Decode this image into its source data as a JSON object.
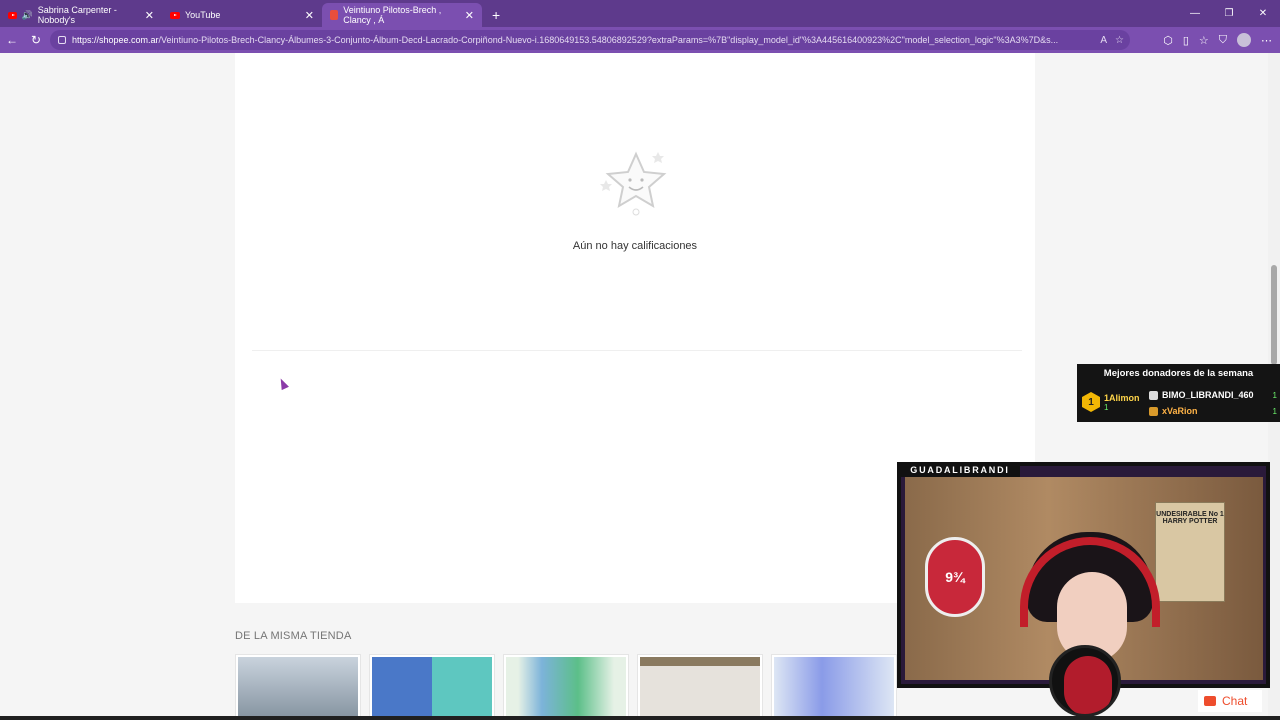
{
  "browser": {
    "tabs": [
      {
        "title": "Sabrina Carpenter - Nobody's",
        "active": false
      },
      {
        "title": "YouTube",
        "active": false
      },
      {
        "title": "Veintiuno Pilotos-Brech , Clancy , Á",
        "active": true
      }
    ],
    "url_host": "https://shopee.com.ar",
    "url_path": "/Veintiuno-Pilotos-Brech-Clancy-Álbumes-3-Conjunto-Álbum-Decd-Lacrado-Corpiñond-Nuevo-i.1680649153.54806892529?extraParams=%7B\"display_model_id\"%3A445616400923%2C\"model_selection_logic\"%3A3%7D&s..."
  },
  "reviews": {
    "empty_message": "Aún no hay calificaciones"
  },
  "same_store": {
    "title": "DE LA MISMA TIENDA",
    "products": [
      {
        "name": "product-1",
        "color": "#c9d3dd"
      },
      {
        "name": "product-2",
        "color": "#d7e7f2"
      },
      {
        "name": "product-3",
        "color": "#e6f1e6"
      },
      {
        "name": "product-4",
        "color": "#d8cfc7"
      },
      {
        "name": "product-5",
        "color": "#dde6f4"
      }
    ]
  },
  "donors_widget": {
    "title": "Mejores donadores de la semana",
    "rank_badge": "1",
    "top": {
      "name": "1Alimon",
      "count": "1"
    },
    "others": [
      {
        "name": "BIMO_LIBRANDI_460",
        "count": "1"
      },
      {
        "name": "xVaRion",
        "count": "1"
      }
    ]
  },
  "webcam": {
    "label": "GUADALIBRANDI",
    "platform_text": "9¾",
    "poster_text": "UNDESIRABLE No 1 HARRY POTTER"
  },
  "chat": {
    "label": "Chat"
  },
  "colors": {
    "brand": "#ee4d2d",
    "browser_chrome": "#7b4fb0"
  }
}
